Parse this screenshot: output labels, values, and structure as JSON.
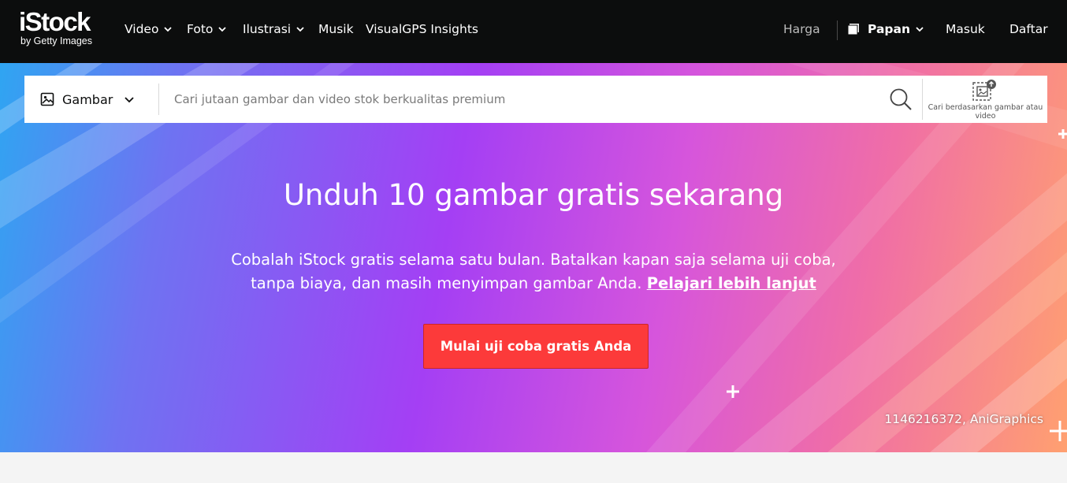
{
  "header": {
    "logo": {
      "main": "iStock",
      "sub": "by Getty Images"
    },
    "nav_left": [
      {
        "label": "Video",
        "has_dropdown": true
      },
      {
        "label": "Foto",
        "has_dropdown": true
      },
      {
        "label": "Ilustrasi",
        "has_dropdown": true
      },
      {
        "label": "Musik",
        "has_dropdown": false
      },
      {
        "label": "VisualGPS Insights",
        "has_dropdown": false
      }
    ],
    "nav_right": {
      "pricing": "Harga",
      "boards": "Papan",
      "sign_in": "Masuk",
      "register": "Daftar"
    },
    "icons": {
      "boards": "board-icon",
      "dropdown": "chevron-down-icon"
    }
  },
  "search": {
    "type_selected": "Gambar",
    "type_icon": "image-icon",
    "placeholder": "Cari jutaan gambar dan video stok berkualitas premium",
    "search_icon": "search-icon",
    "visual_search_label": "Cari berdasarkan gambar atau video",
    "visual_search_icon": "visual-search-icon"
  },
  "hero": {
    "title": "Unduh 10 gambar gratis sekarang",
    "subtitle": "Cobalah iStock gratis selama satu bulan. Batalkan kapan saja selama uji coba, tanpa biaya, dan masih menyimpan gambar Anda.",
    "learn_more": "Pelajari lebih lanjut",
    "cta": "Mulai uji coba gratis Anda",
    "credit": "1146216372, AniGraphics"
  },
  "colors": {
    "nav_bg": "#0c0d0d",
    "cta": "#fc3a3a",
    "gradient": [
      "#2fa5f2",
      "#a43ff4",
      "#d655dc",
      "#f06ea6",
      "#ffa070"
    ]
  }
}
